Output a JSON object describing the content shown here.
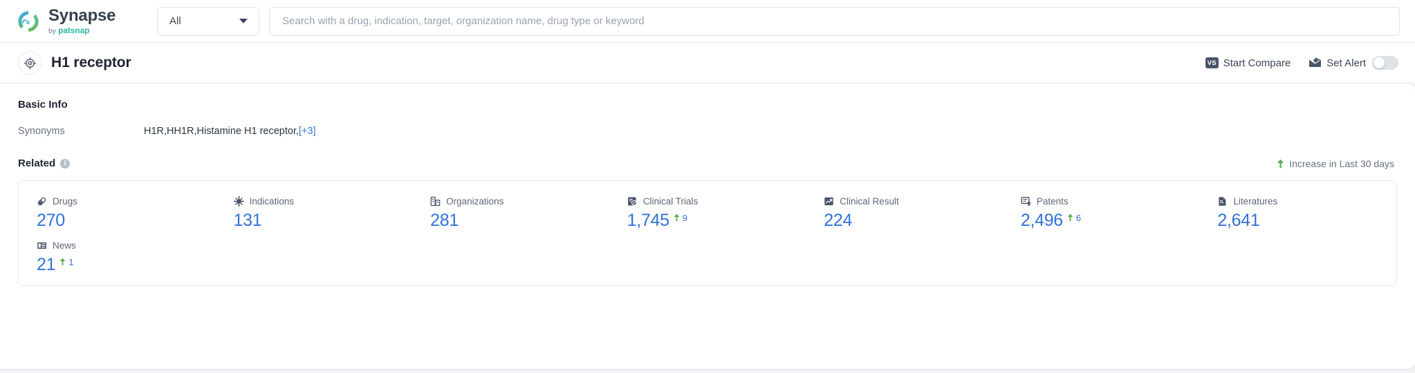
{
  "topbar": {
    "brand_name": "Synapse",
    "brand_by": "by",
    "brand_patsnap": "patsnap",
    "logo_icon": "synapse-swirl-logo",
    "scope_select": {
      "value": "All",
      "caret_icon": "chevron-down-icon"
    },
    "search": {
      "value": "",
      "placeholder": "Search with a drug, indication, target, organization name, drug type or keyword",
      "icon": "search-input"
    }
  },
  "entity_header": {
    "avatar_icon": "target-crosshair-icon",
    "title": "H1 receptor",
    "actions": {
      "compare": {
        "label": "Start Compare",
        "icon": "vs-badge-icon",
        "badge_text": "VS"
      },
      "alert": {
        "label": "Set Alert",
        "icon": "envelope-alert-icon",
        "toggle_state": "off"
      }
    }
  },
  "basic_info": {
    "title": "Basic Info",
    "synonyms_label": "Synonyms",
    "synonyms_value": "H1R,HH1R,Histamine H1 receptor,",
    "synonyms_more": "[+3]"
  },
  "related": {
    "title": "Related",
    "info_icon": "info-icon",
    "info_glyph": "i",
    "increase_note": "Increase in Last 30 days",
    "increase_icon": "arrow-up-icon",
    "accent_blue": "#3272d9",
    "increase_green": "#5aaa4a",
    "items": [
      {
        "label": "Drugs",
        "icon": "pill-capsule-icon",
        "value": "270",
        "delta": null
      },
      {
        "label": "Indications",
        "icon": "virus-icon",
        "value": "131",
        "delta": null
      },
      {
        "label": "Organizations",
        "icon": "building-icon",
        "value": "281",
        "delta": null
      },
      {
        "label": "Clinical Trials",
        "icon": "clinical-trial-icon",
        "value": "1,745",
        "delta": "9"
      },
      {
        "label": "Clinical Result",
        "icon": "clinical-result-icon",
        "value": "224",
        "delta": null
      },
      {
        "label": "Patents",
        "icon": "patent-icon",
        "value": "2,496",
        "delta": "6"
      },
      {
        "label": "Literatures",
        "icon": "document-icon",
        "value": "2,641",
        "delta": null
      },
      {
        "label": "News",
        "icon": "news-icon",
        "value": "21",
        "delta": "1"
      }
    ]
  }
}
